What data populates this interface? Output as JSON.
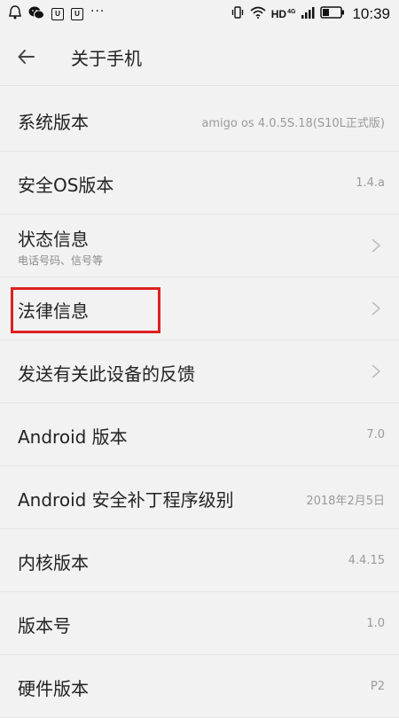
{
  "status_bar": {
    "time": "10:39",
    "network": "HD",
    "network_gen": "4G",
    "left_icons": [
      "app-icon",
      "wechat-icon",
      "u-badge-icon",
      "u-badge-icon",
      "more-dots-icon"
    ],
    "right_icons": [
      "vibrate-icon",
      "wifi-icon",
      "signal-icon",
      "battery-icon"
    ],
    "badge_letter": "U",
    "dots": "···"
  },
  "app_bar": {
    "title": "关于手机",
    "back_icon": "arrow-left-icon"
  },
  "rows": [
    {
      "label": "系统版本",
      "value": "amigo os 4.0.5S.18(S10L正式版)"
    },
    {
      "label": "安全OS版本",
      "value": "1.4.a"
    },
    {
      "label": "状态信息",
      "sub": "电话号码、信号等",
      "icon": "chevron-right-icon"
    },
    {
      "label": "法律信息",
      "icon": "chevron-right-icon"
    },
    {
      "label": "发送有关此设备的反馈",
      "icon": "chevron-right-icon"
    },
    {
      "label": "Android 版本",
      "value": "7.0"
    },
    {
      "label": "Android 安全补丁程序级别",
      "value": "2018年2月5日"
    },
    {
      "label": "内核版本",
      "value": "4.4.15"
    },
    {
      "label": "版本号",
      "value": "1.0"
    },
    {
      "label": "硬件版本",
      "value": "P2"
    }
  ],
  "colors": {
    "background": "#f2f2f2",
    "highlight": "#e02020",
    "text": "#222222",
    "secondary_text": "#9a9a9a"
  }
}
